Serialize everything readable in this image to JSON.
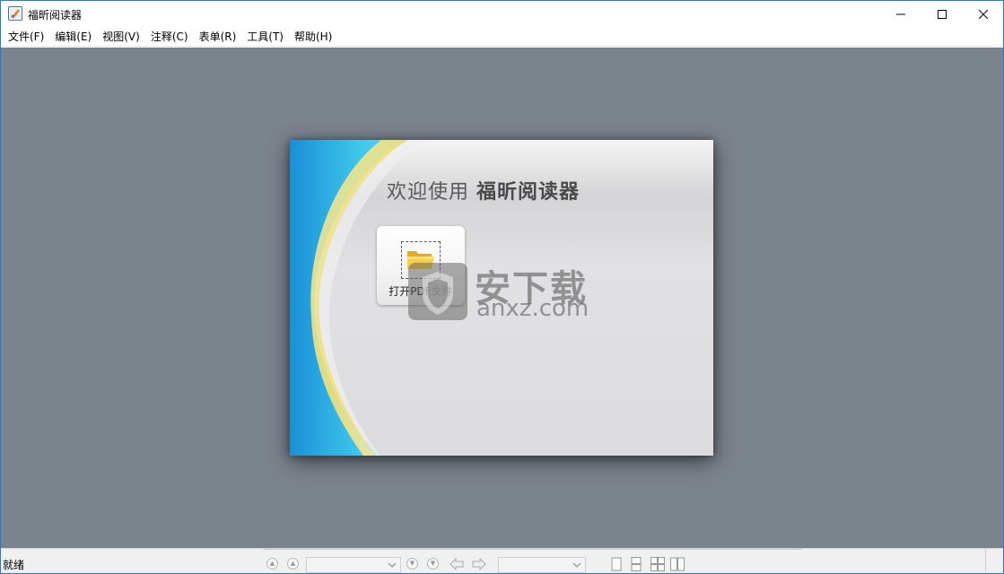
{
  "window": {
    "title": "福昕阅读器",
    "controls": {
      "minimize": "minimize-icon",
      "maximize": "maximize-icon",
      "close": "close-icon"
    }
  },
  "menu": {
    "items": [
      {
        "label": "文件(F)"
      },
      {
        "label": "编辑(E)"
      },
      {
        "label": "视图(V)"
      },
      {
        "label": "注释(C)"
      },
      {
        "label": "表单(R)"
      },
      {
        "label": "工具(T)"
      },
      {
        "label": "帮助(H)"
      }
    ]
  },
  "welcome": {
    "title_prefix": "欢迎使用",
    "title_app": "福昕阅读器",
    "open_button_label": "打开PDF文件"
  },
  "watermark": {
    "text_cn": "安下载",
    "text_en": "anxz.com"
  },
  "status": {
    "text": "就绪",
    "page_combo_value": "",
    "zoom_combo_value": ""
  },
  "colors": {
    "workspace_bg": "#7b838d",
    "window_border": "#2b78d8",
    "swoosh_blue": "#3fc8ec",
    "swoosh_yellow": "#f2e07a"
  }
}
